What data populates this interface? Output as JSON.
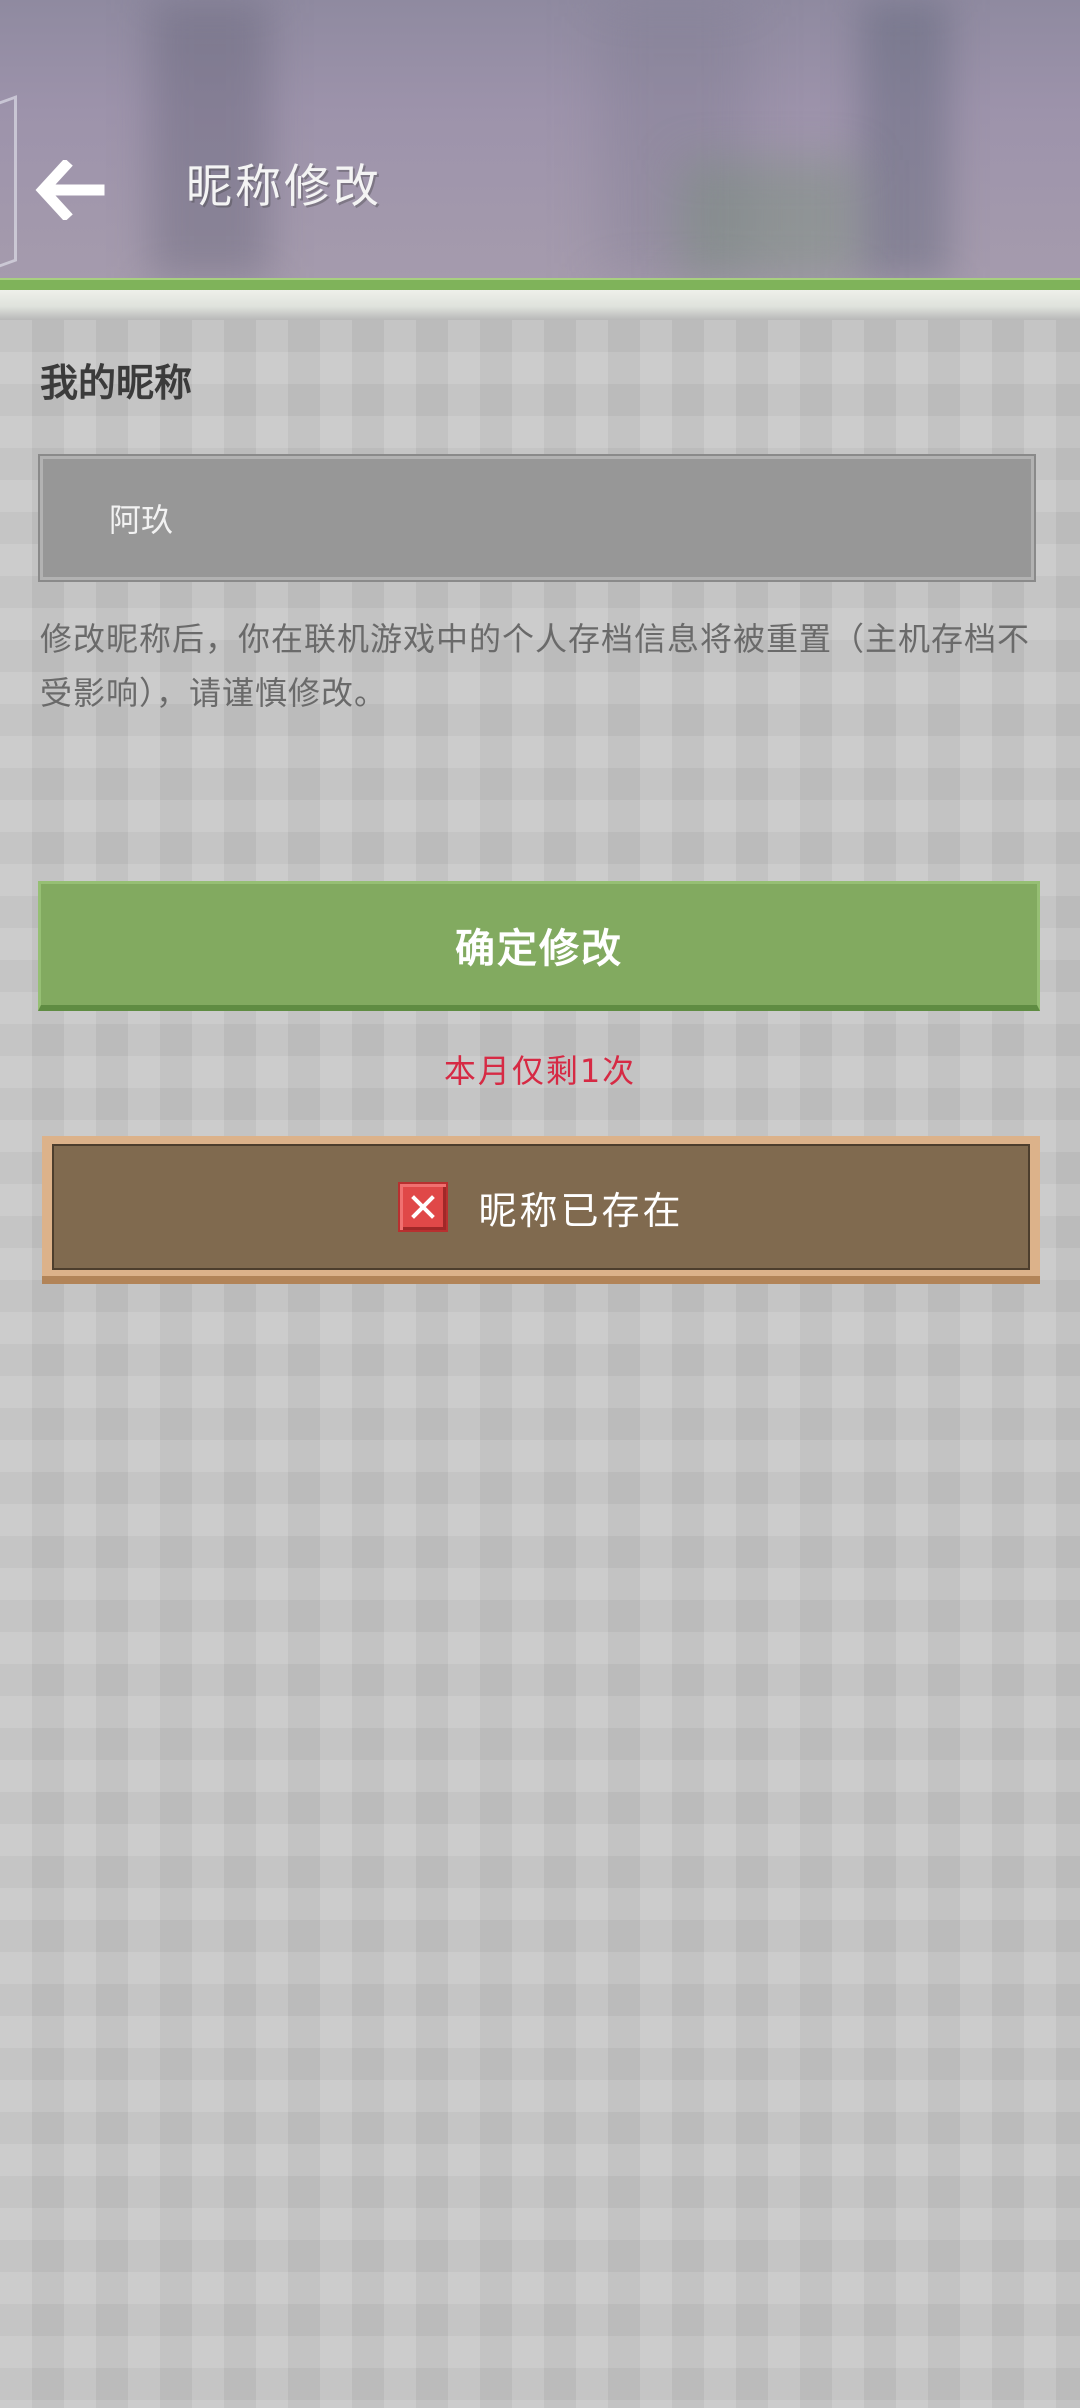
{
  "header": {
    "title": "昵称修改",
    "back_icon": "arrow-left-icon"
  },
  "section": {
    "title": "我的昵称"
  },
  "nickname_field": {
    "value": "阿玖"
  },
  "notice": {
    "text": "修改昵称后，你在联机游戏中的个人存档信息将被重置（主机存档不受影响），请谨慎修改。"
  },
  "confirm_button": {
    "label": "确定修改"
  },
  "remaining": {
    "text": "本月仅剩1次"
  },
  "toast": {
    "icon": "close-icon",
    "text": "昵称已存在"
  },
  "colors": {
    "accent_green": "#82aa60",
    "warning_red": "#d62a44",
    "toast_brown": "#806a4f",
    "error_icon_red": "#e04848"
  }
}
